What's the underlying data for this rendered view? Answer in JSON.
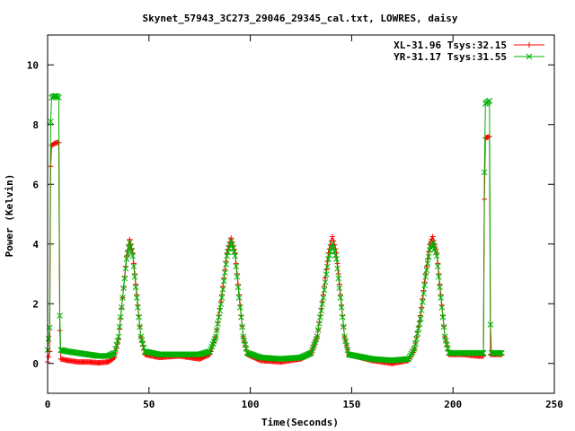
{
  "chart_data": {
    "type": "line",
    "title": "Skynet_57943_3C273_29046_29345_cal.txt, LOWRES, daisy",
    "xlabel": "Time(Seconds)",
    "ylabel": "Power (Kelvin)",
    "xlim": [
      0,
      250
    ],
    "ylim": [
      -1,
      11
    ],
    "xticks": [
      "0",
      "50",
      "100",
      "150",
      "200",
      "250"
    ],
    "yticks": [
      "0",
      "2",
      "4",
      "6",
      "8",
      "10"
    ],
    "xtick_values": [
      0,
      50,
      100,
      150,
      200,
      250
    ],
    "ytick_values": [
      0,
      2,
      4,
      6,
      8,
      10
    ],
    "grid": false,
    "legend_position": "top-right",
    "series": [
      {
        "name": "XL-31.96 Tsys:32.15",
        "color": "#ff0000",
        "marker": "plus",
        "anchors": [
          [
            0,
            0.05
          ],
          [
            1,
            0.4
          ],
          [
            1.5,
            6.6
          ],
          [
            2,
            7.3
          ],
          [
            3,
            7.35
          ],
          [
            4.5,
            7.4
          ],
          [
            5.5,
            7.4
          ],
          [
            6,
            1.1
          ],
          [
            6.5,
            0.15
          ],
          [
            10,
            0.1
          ],
          [
            15,
            0.05
          ],
          [
            20,
            0.05
          ],
          [
            25,
            0.02
          ],
          [
            30,
            0.05
          ],
          [
            33,
            0.2
          ],
          [
            35,
            0.8
          ],
          [
            37,
            2.2
          ],
          [
            39,
            3.6
          ],
          [
            40.5,
            4.15
          ],
          [
            42,
            3.7
          ],
          [
            44,
            2.3
          ],
          [
            46,
            0.9
          ],
          [
            48,
            0.3
          ],
          [
            55,
            0.2
          ],
          [
            65,
            0.25
          ],
          [
            75,
            0.15
          ],
          [
            80,
            0.3
          ],
          [
            83,
            0.9
          ],
          [
            86,
            2.3
          ],
          [
            88.5,
            3.7
          ],
          [
            90.5,
            4.2
          ],
          [
            92.5,
            3.7
          ],
          [
            94.5,
            2.3
          ],
          [
            96.5,
            0.9
          ],
          [
            98.5,
            0.3
          ],
          [
            105,
            0.1
          ],
          [
            115,
            0.05
          ],
          [
            125,
            0.15
          ],
          [
            130,
            0.35
          ],
          [
            133,
            0.9
          ],
          [
            136,
            2.3
          ],
          [
            138.5,
            3.7
          ],
          [
            140.5,
            4.25
          ],
          [
            142.5,
            3.7
          ],
          [
            144.5,
            2.3
          ],
          [
            146.5,
            0.9
          ],
          [
            148.5,
            0.3
          ],
          [
            160,
            0.1
          ],
          [
            170,
            0.0
          ],
          [
            178,
            0.1
          ],
          [
            181,
            0.5
          ],
          [
            184,
            1.6
          ],
          [
            186.5,
            3.0
          ],
          [
            188.5,
            4.0
          ],
          [
            190,
            4.25
          ],
          [
            192,
            3.7
          ],
          [
            194,
            2.3
          ],
          [
            196,
            0.9
          ],
          [
            198,
            0.3
          ],
          [
            205,
            0.3
          ],
          [
            212,
            0.25
          ],
          [
            215,
            0.25
          ],
          [
            215.5,
            5.5
          ],
          [
            216,
            7.55
          ],
          [
            218,
            7.6
          ],
          [
            218.5,
            0.3
          ],
          [
            220,
            0.3
          ],
          [
            224,
            0.3
          ]
        ]
      },
      {
        "name": "YR-31.17 Tsys:31.55",
        "color": "#00b000",
        "marker": "cross",
        "anchors": [
          [
            0,
            0.45
          ],
          [
            1,
            1.2
          ],
          [
            1.5,
            8.1
          ],
          [
            2,
            8.9
          ],
          [
            3,
            8.95
          ],
          [
            4.5,
            8.95
          ],
          [
            5.5,
            8.9
          ],
          [
            6,
            1.6
          ],
          [
            6.5,
            0.45
          ],
          [
            10,
            0.4
          ],
          [
            15,
            0.35
          ],
          [
            20,
            0.3
          ],
          [
            25,
            0.25
          ],
          [
            30,
            0.25
          ],
          [
            33,
            0.35
          ],
          [
            35,
            0.9
          ],
          [
            37,
            2.2
          ],
          [
            39,
            3.5
          ],
          [
            40.5,
            4.05
          ],
          [
            42,
            3.6
          ],
          [
            44,
            2.2
          ],
          [
            46,
            0.9
          ],
          [
            48,
            0.4
          ],
          [
            55,
            0.3
          ],
          [
            65,
            0.3
          ],
          [
            75,
            0.3
          ],
          [
            80,
            0.4
          ],
          [
            83,
            0.9
          ],
          [
            86,
            2.2
          ],
          [
            88.5,
            3.6
          ],
          [
            90.5,
            4.1
          ],
          [
            92.5,
            3.6
          ],
          [
            94.5,
            2.2
          ],
          [
            96.5,
            0.9
          ],
          [
            98.5,
            0.35
          ],
          [
            105,
            0.2
          ],
          [
            115,
            0.15
          ],
          [
            125,
            0.2
          ],
          [
            130,
            0.35
          ],
          [
            133,
            0.9
          ],
          [
            136,
            2.2
          ],
          [
            138.5,
            3.5
          ],
          [
            140.5,
            4.0
          ],
          [
            142.5,
            3.5
          ],
          [
            144.5,
            2.2
          ],
          [
            146.5,
            0.9
          ],
          [
            148.5,
            0.3
          ],
          [
            160,
            0.15
          ],
          [
            170,
            0.1
          ],
          [
            178,
            0.15
          ],
          [
            181,
            0.5
          ],
          [
            184,
            1.5
          ],
          [
            186.5,
            2.9
          ],
          [
            188.5,
            3.8
          ],
          [
            190,
            4.05
          ],
          [
            192,
            3.6
          ],
          [
            194,
            2.2
          ],
          [
            196,
            0.9
          ],
          [
            198,
            0.35
          ],
          [
            205,
            0.35
          ],
          [
            212,
            0.35
          ],
          [
            215,
            0.35
          ],
          [
            215.5,
            6.4
          ],
          [
            216,
            8.7
          ],
          [
            218,
            8.8
          ],
          [
            218.5,
            1.3
          ],
          [
            219,
            0.35
          ],
          [
            224,
            0.35
          ]
        ]
      }
    ]
  }
}
